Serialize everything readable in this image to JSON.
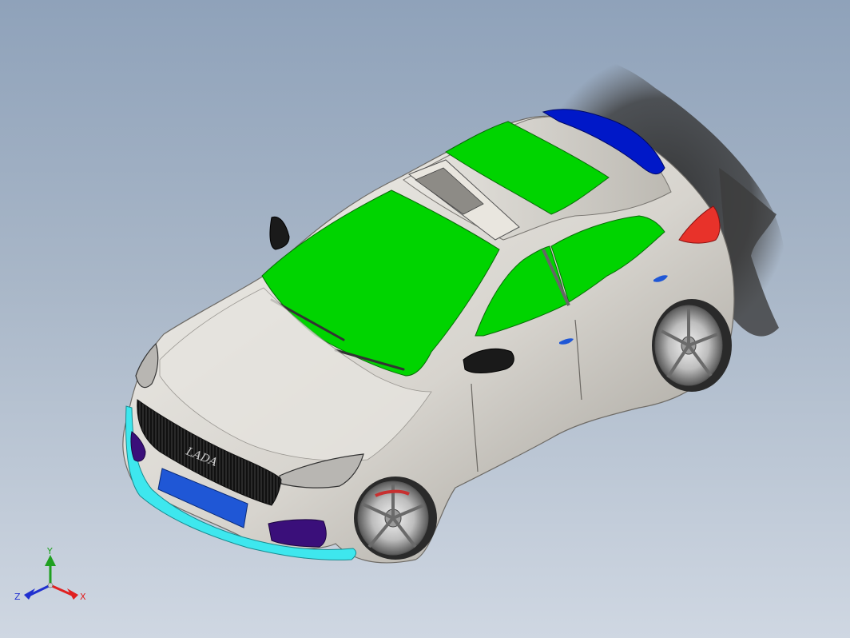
{
  "viewport": {
    "background_top": "#8fa2ba",
    "background_bottom": "#cfd7e2"
  },
  "model": {
    "name": "car-assembly",
    "colors": {
      "body": "#d9d6d0",
      "glass": "#00d400",
      "front_bumper": "#3ee7ee",
      "plate": "#1f57d6",
      "fog_lights": "#3a0f7a",
      "spoiler": "#0018c8",
      "taillight": "#e8322a",
      "grille": "#202020",
      "wheel": "#c9c9c9",
      "shadow": "#3a3a3a"
    },
    "grille_badge": "LADA"
  },
  "triad": {
    "x_label": "X",
    "y_label": "Y",
    "z_label": "Z",
    "x_color": "#e02020",
    "y_color": "#20a020",
    "z_color": "#2030d0"
  }
}
